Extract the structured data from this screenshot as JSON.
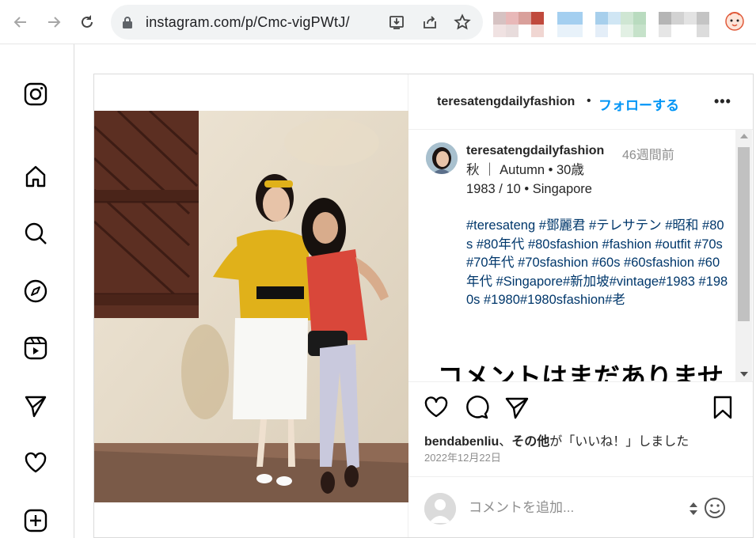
{
  "browser": {
    "url": "instagram.com/p/Cmc-vigPWtJ/"
  },
  "post": {
    "header": {
      "username": "teresatengdailyfashion",
      "separator": "•",
      "follow_label": "フォローする",
      "more_label": "•••"
    },
    "caption": {
      "username": "teresatengdailyfashion",
      "time": "46週間前",
      "line1": "秋 ｜ Autumn • 30歳",
      "line2": "1983 / 10 • Singapore",
      "hashtags": "#teresateng #鄧麗君 #テレサテン #昭和 #80s #80年代 #80sfashion #fashion #outfit #70s #70年代 #70sfashion #60s #60sfashion #60年代 #Singapore#新加坡#vintage#1983 #1980s #1980#1980sfashion#老"
    },
    "no_comments": "コメントはまだありませ",
    "likes": {
      "user": "bendabenliu",
      "sep": "、",
      "others": "その他",
      "rest": "が「いいね！」しました"
    },
    "date": "2022年12月22日",
    "comment_placeholder": "コメントを追加..."
  },
  "colors": {
    "accent": "#0095f6",
    "hashtag": "#00376b",
    "muted": "#8e8e8e"
  }
}
